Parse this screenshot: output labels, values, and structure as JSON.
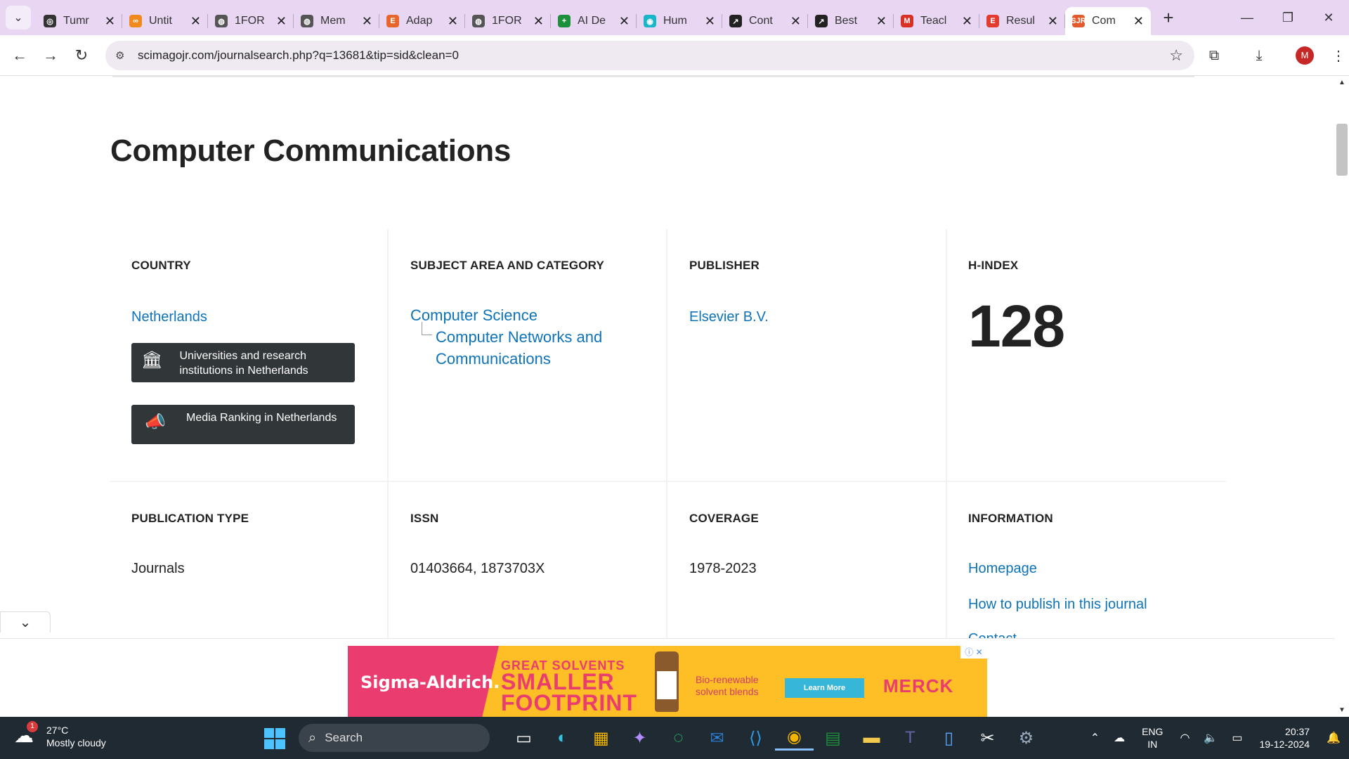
{
  "browser": {
    "tabs": [
      {
        "title": "Tumr",
        "favicon_color": "#333333",
        "favicon_glyph": "◎"
      },
      {
        "title": "Untit",
        "favicon_color": "#f0891e",
        "favicon_glyph": "∞"
      },
      {
        "title": "1FOR",
        "favicon_color": "#555555",
        "favicon_glyph": "◍"
      },
      {
        "title": "Mem",
        "favicon_color": "#555555",
        "favicon_glyph": "◍"
      },
      {
        "title": "Adap",
        "favicon_color": "#e8662c",
        "favicon_glyph": "E"
      },
      {
        "title": "1FOR",
        "favicon_color": "#555555",
        "favicon_glyph": "◍"
      },
      {
        "title": "AI De",
        "favicon_color": "#1e8f3a",
        "favicon_glyph": "+"
      },
      {
        "title": "Hum",
        "favicon_color": "#19b6c9",
        "favicon_glyph": "◉"
      },
      {
        "title": "Cont",
        "favicon_color": "#222222",
        "favicon_glyph": "↗"
      },
      {
        "title": "Best",
        "favicon_color": "#222222",
        "favicon_glyph": "↗"
      },
      {
        "title": "Teacl",
        "favicon_color": "#d93025",
        "favicon_glyph": "M"
      },
      {
        "title": "Resul",
        "favicon_color": "#e33b2f",
        "favicon_glyph": "E"
      },
      {
        "title": "Com",
        "favicon_color": "#e35b2c",
        "favicon_glyph": "SJR",
        "active": true
      }
    ],
    "url": "scimagojr.com/journalsearch.php?q=13681&tip=sid&clean=0",
    "profile_initial": "M"
  },
  "journal": {
    "title": "Computer Communications",
    "country": {
      "label": "COUNTRY",
      "value": "Netherlands"
    },
    "buttons": {
      "universities": "Universities and research institutions in Netherlands",
      "media": "Media Ranking in Netherlands"
    },
    "subject": {
      "label": "SUBJECT AREA AND CATEGORY",
      "area": "Computer Science",
      "category": "Computer Networks and Communications"
    },
    "publisher": {
      "label": "PUBLISHER",
      "value": "Elsevier B.V."
    },
    "hindex": {
      "label": "H-INDEX",
      "value": "128"
    },
    "publication_type": {
      "label": "PUBLICATION TYPE",
      "value": "Journals"
    },
    "issn": {
      "label": "ISSN",
      "value": "01403664, 1873703X"
    },
    "coverage": {
      "label": "COVERAGE",
      "value": "1978-2023"
    },
    "information": {
      "label": "INFORMATION",
      "links": [
        "Homepage",
        "How to publish in this journal",
        "Contact"
      ]
    }
  },
  "ad": {
    "brand": "Sigma-Aldrich.",
    "headline_top": "GREAT SOLVENTS",
    "headline_main": "SMALLER FOOTPRINT",
    "tagline": "Bio-renewable solvent blends",
    "cta": "Learn More",
    "sponsor": "MERCK"
  },
  "taskbar": {
    "weather_temp": "27°C",
    "weather_desc": "Mostly cloudy",
    "weather_badge": "1",
    "search_placeholder": "Search",
    "lang_line1": "ENG",
    "lang_line2": "IN",
    "time": "20:37",
    "date": "19-12-2024"
  }
}
